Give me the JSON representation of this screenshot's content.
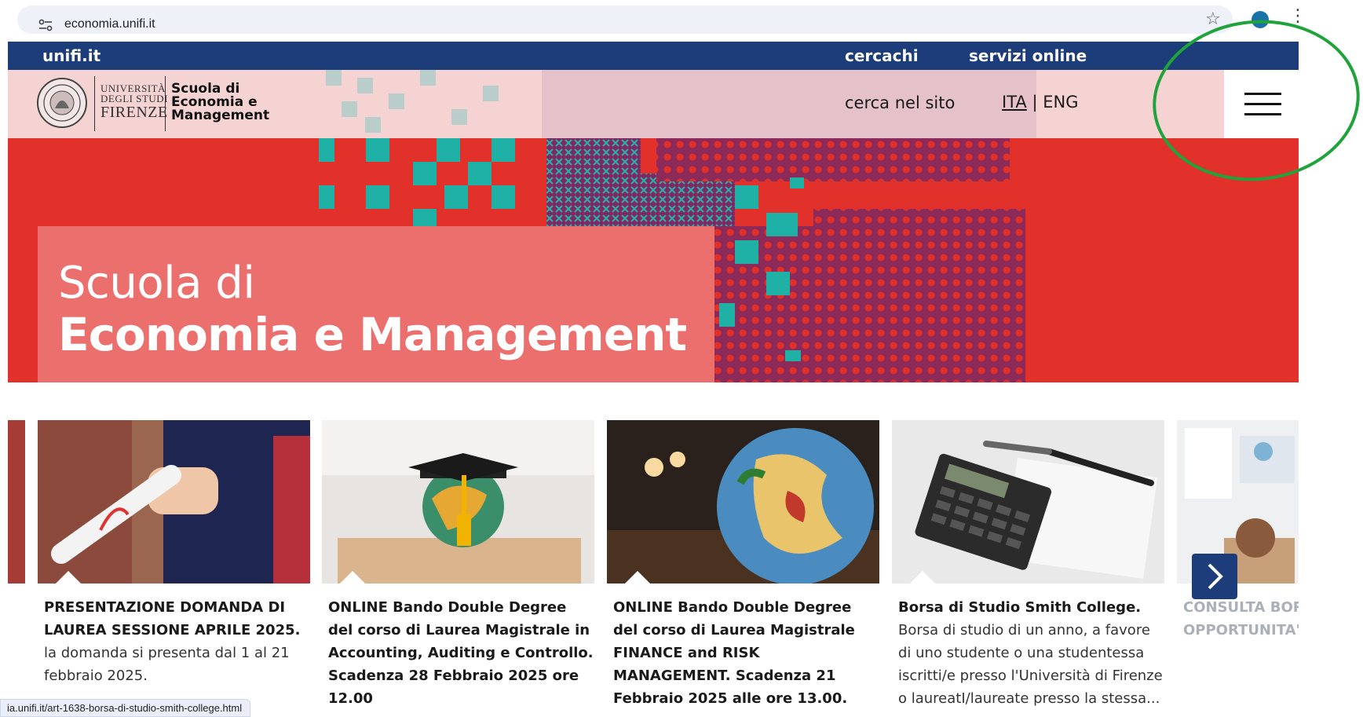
{
  "browser": {
    "url": "economia.unifi.it",
    "icons": [
      "tune-icon",
      "star-icon",
      "profile-icon",
      "kebab-menu-icon"
    ]
  },
  "topbar": {
    "brand": "unifi.it",
    "links": [
      "cercachi",
      "servizi online"
    ]
  },
  "header": {
    "university": [
      "UNIVERSITÀ",
      "DEGLI STUDI",
      "FIRENZE"
    ],
    "school": [
      "Scuola di",
      "Economia e",
      "Management"
    ],
    "search_label": "cerca nel sito",
    "lang_ita": "ITA",
    "lang_sep": "|",
    "lang_eng": "ENG",
    "menu_icon": "hamburger-menu-icon"
  },
  "hero": {
    "line1": "Scuola di",
    "line2": "Economia e Management"
  },
  "cards": [
    {
      "title": "PRESENTAZIONE DOMANDA DI LAUREA SESSIONE APRILE 2025.",
      "body": " la domanda si presenta dal 1 al 21 febbraio 2025."
    },
    {
      "title": "ONLINE Bando Double Degree del corso di Laurea Magistrale in Accounting, Auditing e Controllo.",
      "body": " Scadenza 28 Febbraio 2025 ore 12.00"
    },
    {
      "title": "ONLINE Bando Double Degree del corso di Laurea Magistrale FINANCE and RISK MANAGEMENT.",
      "body": " Scadenza 21 Febbraio 2025 alle ore 13.00."
    },
    {
      "title": "Borsa di Studio Smith College.",
      "body": " Borsa di studio di un anno, a favore di uno studente o una studentessa iscritti/e presso l'Università di Firenze o laureatI/laureate presso la stessa..."
    },
    {
      "title": "CONSULTA BORSE E OPPORTUNITA' L",
      "body": ""
    }
  ],
  "status_url": "ia.unifi.it/art-1638-borsa-di-studio-smith-college.html",
  "colors": {
    "topbar": "#1c3d7a",
    "header": "#f5d3d3",
    "hero_red": "#e2312a",
    "teal": "#1fb1a6",
    "purple": "#8e2a5a",
    "annotation_green": "#1fa33a"
  }
}
